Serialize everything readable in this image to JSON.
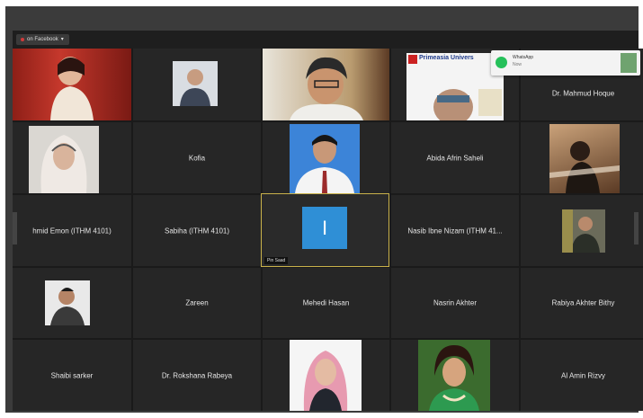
{
  "toolbar": {
    "recording_label": "on Facebook"
  },
  "notification": {
    "title": "WhatsApp",
    "subtitle": "Now"
  },
  "grid": {
    "row1": {
      "t5_name": "Dr. Mahmud Hoque",
      "banner_text": "Primeasia Univers"
    },
    "row2": {
      "t2_name": "Kofia",
      "t4_name": "Abida Afrin Saheli"
    },
    "row3": {
      "t1_name": "hmid Emon (ITHM 4101)",
      "t2_name": "Sabiha (ITHM 4101)",
      "t3_letter": "I",
      "t3_label": "Pin Saad",
      "t4_name": "Nasib Ibne Nizam (ITHM 41..."
    },
    "row4": {
      "t2_name": "Zareen",
      "t3_name": "Mehedi Hasan",
      "t4_name": "Nasrin Akhter",
      "t5_name": "Rabiya Akhter Bithy"
    },
    "row5": {
      "t1_name": "Shaibi sarker",
      "t2_name": "Dr. Rokshana Rabeya",
      "t5_name": "Al Amin Rizvy"
    }
  }
}
